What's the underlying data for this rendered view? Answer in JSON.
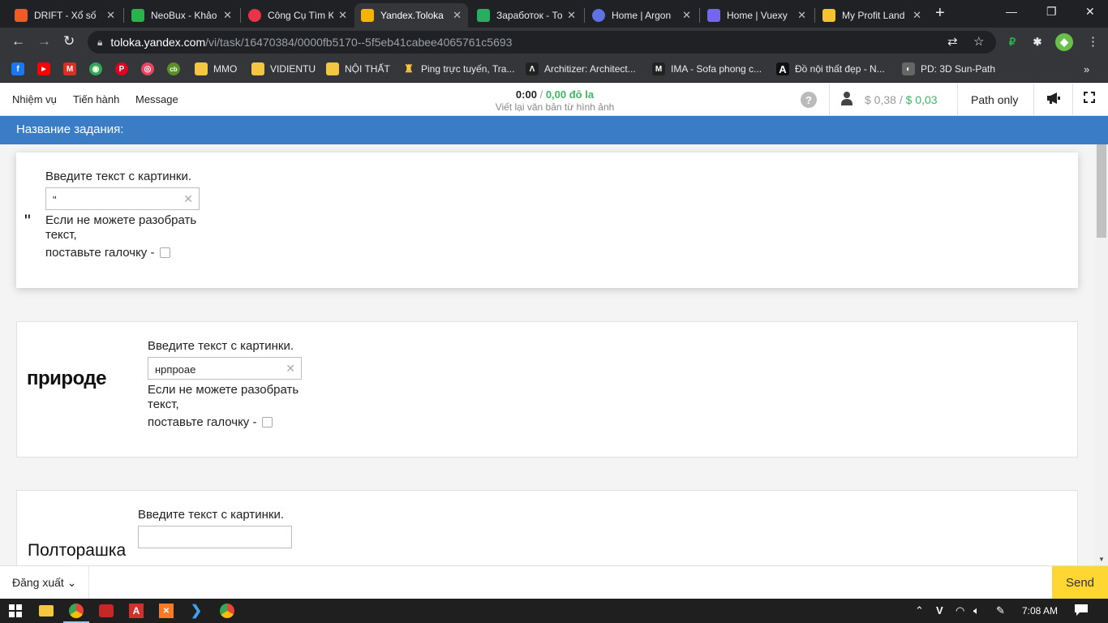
{
  "browser": {
    "tabs": [
      {
        "title": "DRIFT - Xổ số",
        "color": "#f05a28"
      },
      {
        "title": "NeoBux - Khảo",
        "color": "#2bb24c"
      },
      {
        "title": "Công Cụ Tìm K",
        "color": "#e8334a"
      },
      {
        "title": "Yandex.Toloka",
        "color": "#f4b400",
        "active": true
      },
      {
        "title": "Заработок - То",
        "color": "#27ae60"
      },
      {
        "title": "Home | Argon",
        "color": "#5e72e4"
      },
      {
        "title": "Home | Vuexy",
        "color": "#7367f0"
      },
      {
        "title": "My Profit Land",
        "color": "#f4c430"
      }
    ],
    "url_host": "toloka.yandex.com",
    "url_path": "/vi/task/16470384/0000fb5170--5f5eb41cabee4065761c5693",
    "bookmarks": [
      {
        "label": "",
        "color": "#1877f2",
        "glyph": "f"
      },
      {
        "label": "",
        "color": "#ff0000",
        "glyph": "▶"
      },
      {
        "label": "",
        "color": "#d93025",
        "glyph": "M"
      },
      {
        "label": "",
        "color": "#34a853",
        "glyph": "◉"
      },
      {
        "label": "",
        "color": "#e60023",
        "glyph": "P"
      },
      {
        "label": "",
        "color": "#e94560",
        "glyph": "◎"
      },
      {
        "label": "",
        "color": "#5a8f29",
        "glyph": "cb"
      },
      {
        "label": "MMO",
        "color": "#f6c643",
        "glyph": ""
      },
      {
        "label": "VIDIENTU",
        "color": "#f6c643",
        "glyph": ""
      },
      {
        "label": "NỘI THẤT",
        "color": "#f6c643",
        "glyph": ""
      },
      {
        "label": "Ping trực tuyến, Tra...",
        "color": "#f6c643",
        "glyph": "♜"
      },
      {
        "label": "Architizer: Architect...",
        "color": "#222222",
        "glyph": "Λ"
      },
      {
        "label": "IMA - Sofa phong c...",
        "color": "#222222",
        "glyph": "M"
      },
      {
        "label": "Đồ nội thất đẹp - N...",
        "color": "#111111",
        "glyph": "A"
      },
      {
        "label": "PD: 3D Sun-Path",
        "color": "#666666",
        "glyph": "◐"
      }
    ]
  },
  "toloka": {
    "nav": [
      "Nhiệm vụ",
      "Tiến hành",
      "Message"
    ],
    "timer": "0:00",
    "earned": "0,00 đô la",
    "task_subtitle": "Viết lại văn bản từ hình ảnh",
    "balance_gray": "$ 0,38",
    "balance_green": "$ 0,03",
    "path_only": "Path only",
    "task_title": "Название задания:",
    "logout": "Đăng xuất",
    "send": "Send"
  },
  "cards": [
    {
      "image_text": "\"",
      "label": "Введите текст с картинки.",
      "value": "\"",
      "hint": "Если не можете разобрать текст,",
      "hint2": "поставьте галочку -"
    },
    {
      "image_text": "природе",
      "label": "Введите текст с картинки.",
      "value": "нрпроае",
      "hint": "Если не можете разобрать текст,",
      "hint2": "поставьте галочку -"
    },
    {
      "image_text": "Полторашка",
      "label": "Введите текст с картинки.",
      "value": "",
      "hint": "",
      "hint2": ""
    }
  ],
  "taskbar": {
    "time": "7:08 AM",
    "lang": "V"
  },
  "colors": {
    "accent_blue": "#3a7cc5",
    "money_green": "#3cb95f",
    "send_yellow": "#ffd632"
  }
}
